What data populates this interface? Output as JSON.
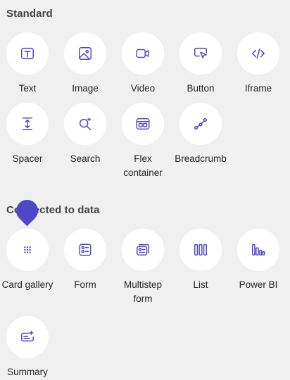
{
  "standard": {
    "title": "Standard",
    "items": [
      {
        "label": "Text",
        "icon": "text-icon"
      },
      {
        "label": "Image",
        "icon": "image-icon"
      },
      {
        "label": "Video",
        "icon": "video-icon"
      },
      {
        "label": "Button",
        "icon": "button-icon"
      },
      {
        "label": "Iframe",
        "icon": "iframe-icon"
      },
      {
        "label": "Spacer",
        "icon": "spacer-icon"
      },
      {
        "label": "Search",
        "icon": "search-icon"
      },
      {
        "label": "Flex container",
        "icon": "flex-container-icon"
      },
      {
        "label": "Breadcrumb",
        "icon": "breadcrumb-icon"
      }
    ]
  },
  "connected": {
    "title": "Connected to data",
    "items": [
      {
        "label": "Card gallery",
        "icon": "card-gallery-icon"
      },
      {
        "label": "Form",
        "icon": "form-icon"
      },
      {
        "label": "Multistep form",
        "icon": "multistep-form-icon"
      },
      {
        "label": "List",
        "icon": "list-icon"
      },
      {
        "label": "Power BI",
        "icon": "power-bi-icon"
      },
      {
        "label": "Summary",
        "icon": "summary-icon"
      }
    ]
  },
  "colors": {
    "accent": "#4f46c8",
    "icon": "#4f46c8",
    "background": "#f0f0f0",
    "circle": "#ffffff"
  }
}
